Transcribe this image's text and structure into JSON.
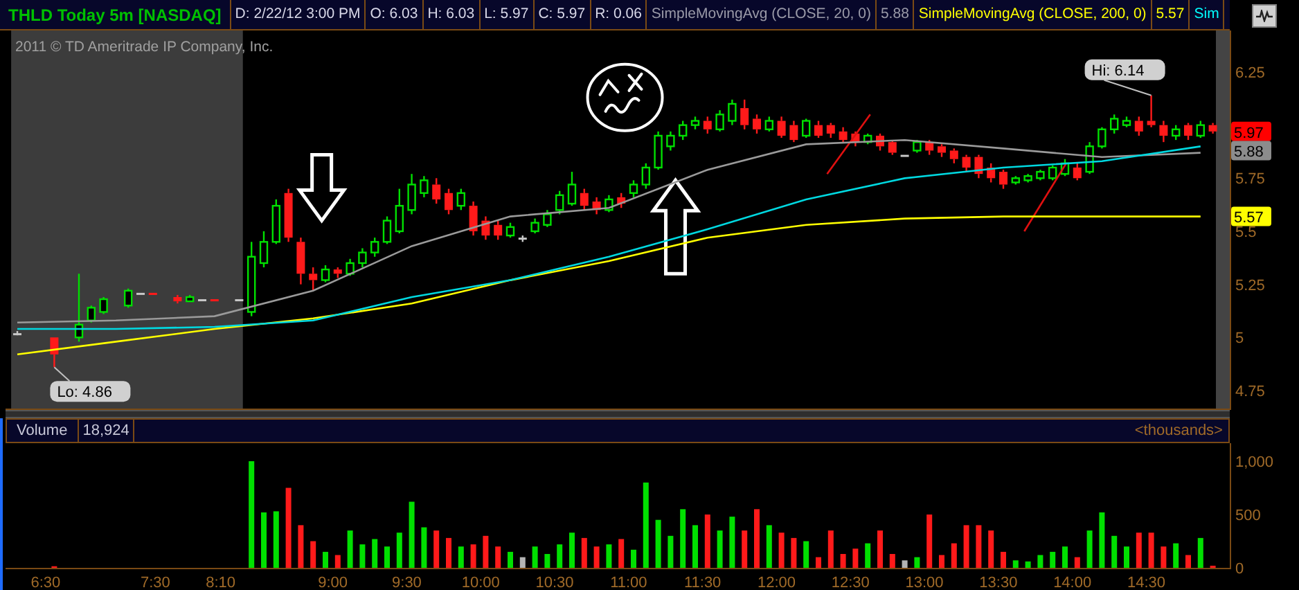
{
  "header": {
    "title": "THLD Today 5m [NASDAQ]",
    "fields": [
      {
        "text": "D: 2/22/12 3:00 PM",
        "kind": "quote"
      },
      {
        "text": "O: 6.03",
        "kind": "quote"
      },
      {
        "text": "H: 6.03",
        "kind": "quote"
      },
      {
        "text": "L: 5.97",
        "kind": "quote"
      },
      {
        "text": "C: 5.97",
        "kind": "quote"
      },
      {
        "text": "R: 0.06",
        "kind": "quote"
      },
      {
        "text": "SimpleMovingAvg (CLOSE, 20, 0)",
        "kind": "sma20"
      },
      {
        "text": "5.88",
        "kind": "sma20"
      },
      {
        "text": "SimpleMovingAvg (CLOSE, 200, 0)",
        "kind": "sma200"
      },
      {
        "text": "5.57",
        "kind": "sma200"
      },
      {
        "text": "Sim",
        "kind": "study3"
      }
    ]
  },
  "price_panel": {
    "copyright": "2011 © TD Ameritrade IP Company, Inc.",
    "chart_data": {
      "type": "line",
      "categories": [
        null,
        null,
        null,
        null,
        null,
        null,
        null,
        null,
        null,
        null,
        null,
        null,
        null
      ],
      "ylim": [
        4.665,
        6.446
      ],
      "yticks": [
        6.25,
        5.75,
        5.5,
        5.25,
        5,
        4.75
      ],
      "series": [
        {
          "color": "#9a9a9a",
          "values": [
            5.07,
            5.08,
            5.1,
            5.22,
            5.43,
            5.57,
            5.61,
            5.79,
            5.91,
            5.93,
            5.89,
            5.85,
            5.87
          ]
        },
        {
          "color": "#ffff00",
          "values": [
            4.92,
            4.98,
            5.04,
            5.09,
            5.16,
            5.27,
            5.36,
            5.47,
            5.53,
            5.56,
            5.57,
            5.57,
            5.57
          ]
        },
        {
          "color": "#00d8e0",
          "values": [
            5.04,
            5.04,
            5.05,
            5.08,
            5.19,
            5.27,
            5.38,
            5.51,
            5.65,
            5.75,
            5.8,
            5.83,
            5.9
          ]
        }
      ]
    },
    "callouts": [
      {
        "kind": "high",
        "text": "Hi: 6.14"
      },
      {
        "kind": "low",
        "text": "Lo: 4.86"
      }
    ],
    "badges": [
      {
        "text": "5.97",
        "color": "#ff0000"
      },
      {
        "text": "5.88",
        "color": "#8c8c8c"
      },
      {
        "text": "5.57",
        "color": "#ffff00"
      }
    ]
  },
  "volume_panel": {
    "label": "Volume",
    "value": "18,924",
    "units": "<thousands>",
    "axis_labels": [
      "1,000",
      "500",
      "0"
    ],
    "time_labels": [
      "6:30",
      "7:30",
      "8:10",
      "9:00",
      "9:30",
      "10:00",
      "10:30",
      "11:00",
      "11:30",
      "12:00",
      "12:30",
      "13:00",
      "13:30",
      "14:00",
      "14:30"
    ]
  }
}
